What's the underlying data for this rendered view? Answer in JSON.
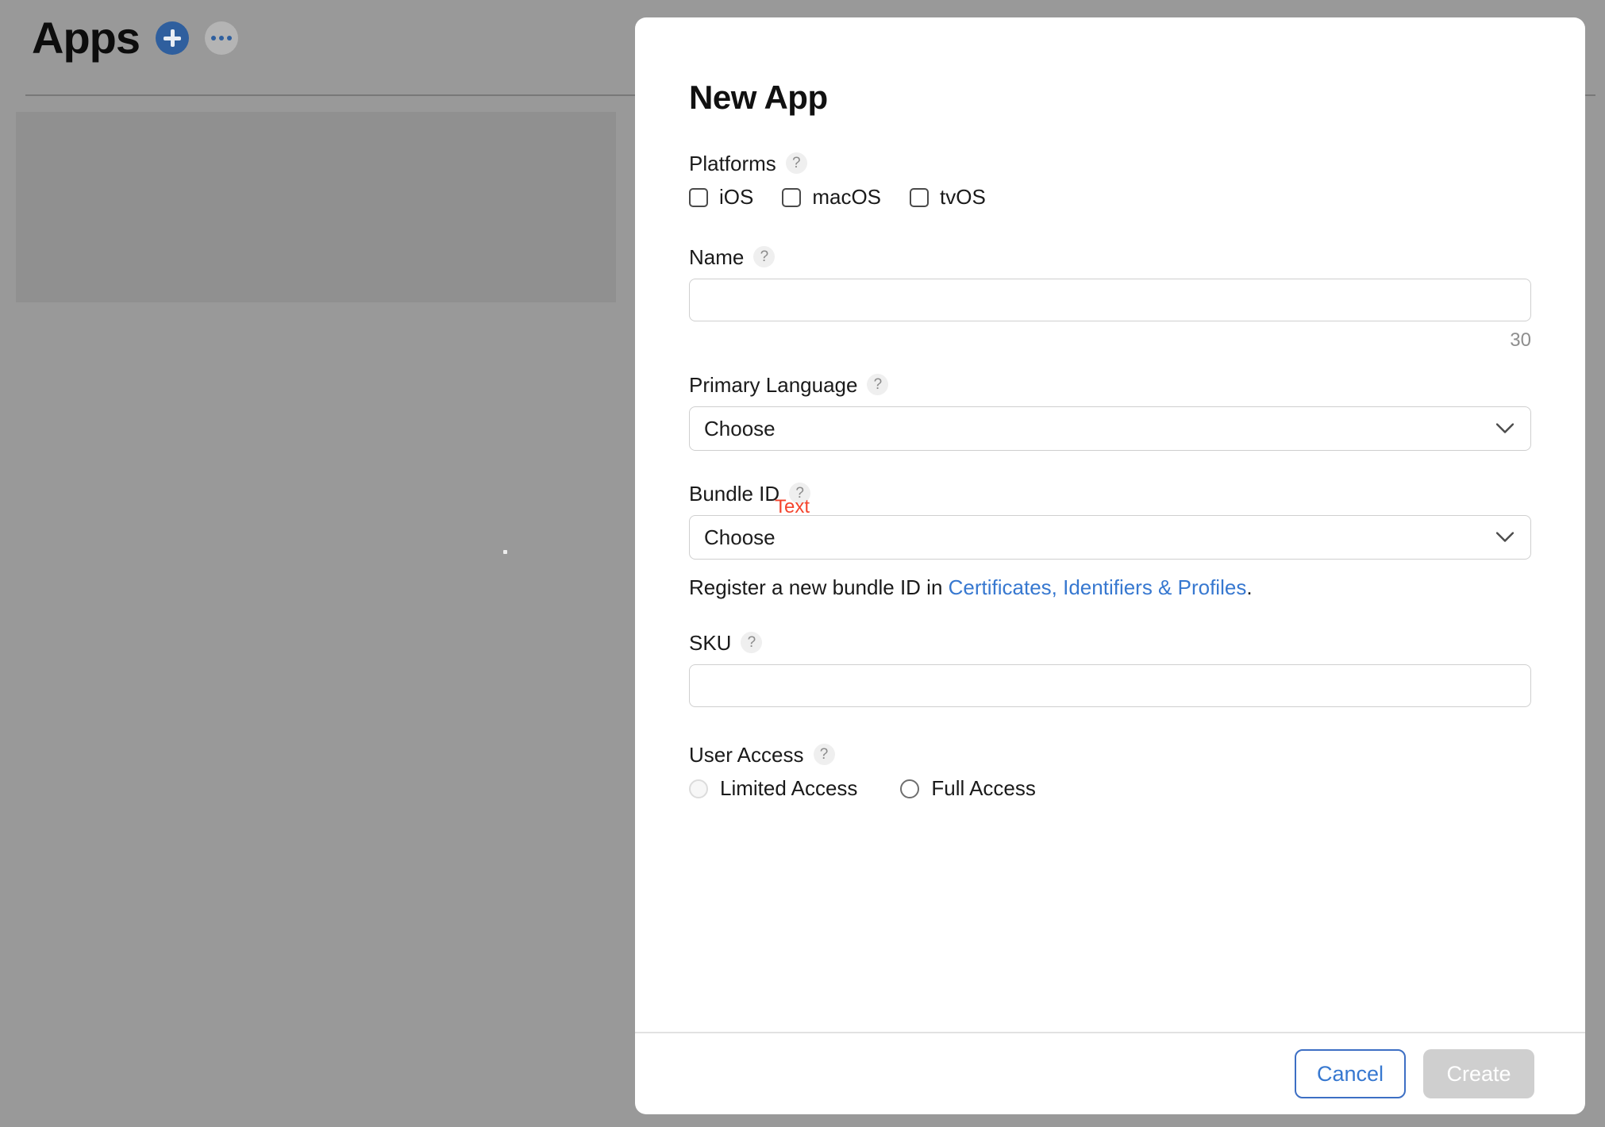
{
  "background": {
    "title": "Apps",
    "add_icon": "plus-icon",
    "more_icon": "ellipsis-icon",
    "overlay_color": "#999999",
    "panel_color": "#909090"
  },
  "modal": {
    "heading": "New App",
    "platforms": {
      "label": "Platforms",
      "help": "?",
      "options": [
        {
          "label": "iOS",
          "checked": false
        },
        {
          "label": "macOS",
          "checked": false
        },
        {
          "label": "tvOS",
          "checked": false
        }
      ]
    },
    "name": {
      "label": "Name",
      "help": "?",
      "value": "",
      "placeholder": "",
      "char_counter": "30"
    },
    "primary_language": {
      "label": "Primary Language",
      "help": "?",
      "selected": "Choose",
      "chevron_icon": "chevron-down-icon"
    },
    "bundle_id": {
      "label": "Bundle ID",
      "help": "?",
      "selected": "Choose",
      "chevron_icon": "chevron-down-icon",
      "annotation": "Text",
      "annotation_color": "#f4452e",
      "helper_prefix": "Register a new bundle ID in ",
      "helper_link": "Certificates, Identifiers & Profiles",
      "helper_suffix": "."
    },
    "sku": {
      "label": "SKU",
      "help": "?",
      "value": "",
      "placeholder": ""
    },
    "user_access": {
      "label": "User Access",
      "help": "?",
      "options": [
        {
          "label": "Limited Access",
          "selected": false,
          "disabled": true
        },
        {
          "label": "Full Access",
          "selected": false,
          "disabled": false
        }
      ]
    },
    "footer": {
      "cancel_label": "Cancel",
      "create_label": "Create",
      "create_disabled": true
    },
    "link_color": "#3778d0",
    "accent_color": "#3d6fc4"
  }
}
